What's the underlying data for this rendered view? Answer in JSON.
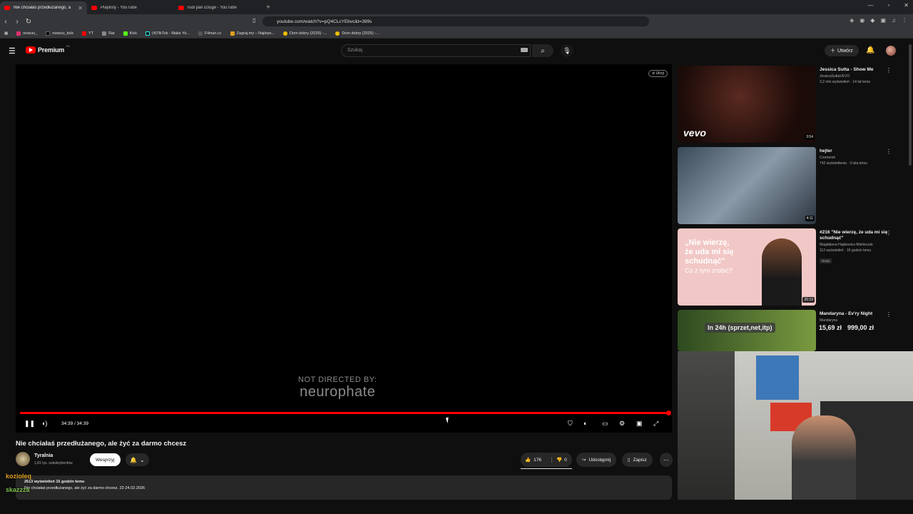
{
  "browser": {
    "tabs": [
      {
        "label": "Nie chciałaś przedłużanego, a"
      },
      {
        "label": "Playlisty - YouTube"
      },
      {
        "label": "rudi pali szluge - YouTube"
      }
    ],
    "url": "youtube.com/watch?v=pQ4CLcYEbvc&t=399s",
    "bookmarks": [
      "nowciu_",
      "nowciu_kick",
      "YT",
      "Rat",
      "Kick",
      "(4)TikTok - Make Yo...",
      "Filman.cc",
      "Zagraj.my – Najleps...",
      "Dom dobry (2025) -...",
      "Dom dobry (2025) -..."
    ]
  },
  "header": {
    "logo_text": "Premium",
    "logo_region": "PL",
    "search_placeholder": "Szukaj",
    "create_label": "Utwórz"
  },
  "player": {
    "hide_label": "Ukryj",
    "credit_line1": "NOT DIRECTED BY:",
    "credit_line2": "neurophate",
    "time": "34:39 / 34:39",
    "progress": 1.0
  },
  "video": {
    "title": "Nie chciałaś przedłużanego, ale żyć za darmo chcesz",
    "channel": "Tyralnia",
    "subscribers": "1,81 tys. subskrybentów",
    "join_label": "Wesprzyj",
    "likes": "176",
    "dislikes": "0",
    "share_label": "Udostępnij",
    "save_label": "Zapisz",
    "desc_line1": "2613 wyświetleń  15 godzin temu",
    "desc_line2": "Nie chciałaś przedłużanego, ale żyć za darmo chcesz. 22-24.02.2026"
  },
  "chat": [
    {
      "user": "kozioleq",
      "color": "#e0a020"
    },
    {
      "user": "skazzza",
      "color": "#7cc04a"
    }
  ],
  "recommendations": [
    {
      "title": "Jessica Sutta - Show Me",
      "channel": "JessicaSuttaVEVO",
      "views": "3,2 mln wyświetleń · 14 lat temu",
      "duration": "3:54",
      "thumb_text": "vevo"
    },
    {
      "title": "hejter",
      "channel": "Cromerek",
      "views": "742 wyświetlenia · 3 lata temu",
      "duration": "4:11"
    },
    {
      "title": "#216 \"Nie wierzę, że uda mi się schudnąć\"",
      "channel": "Magdalena Hajkiewicz-Mielniczuk",
      "views": "112 wyświetleń · 16 godzin temu",
      "duration": "20:19",
      "badge": "Nowy",
      "thumb_line1": "„Nie wierzę,",
      "thumb_line2": "że uda mi się",
      "thumb_line3": "schudnąć\"",
      "thumb_line4": "Co z tym zrobić?"
    },
    {
      "title": "Mandaryna - Ev'ry Night",
      "channel": "Mandaryna",
      "overlay_banner": "In 24h (sprzet,net,itp)",
      "overlay_amount1": "15,69 zł",
      "overlay_amount2": "999,00 zł"
    }
  ],
  "colors": {
    "accent": "#ff0000",
    "background": "#0f0f0f"
  }
}
